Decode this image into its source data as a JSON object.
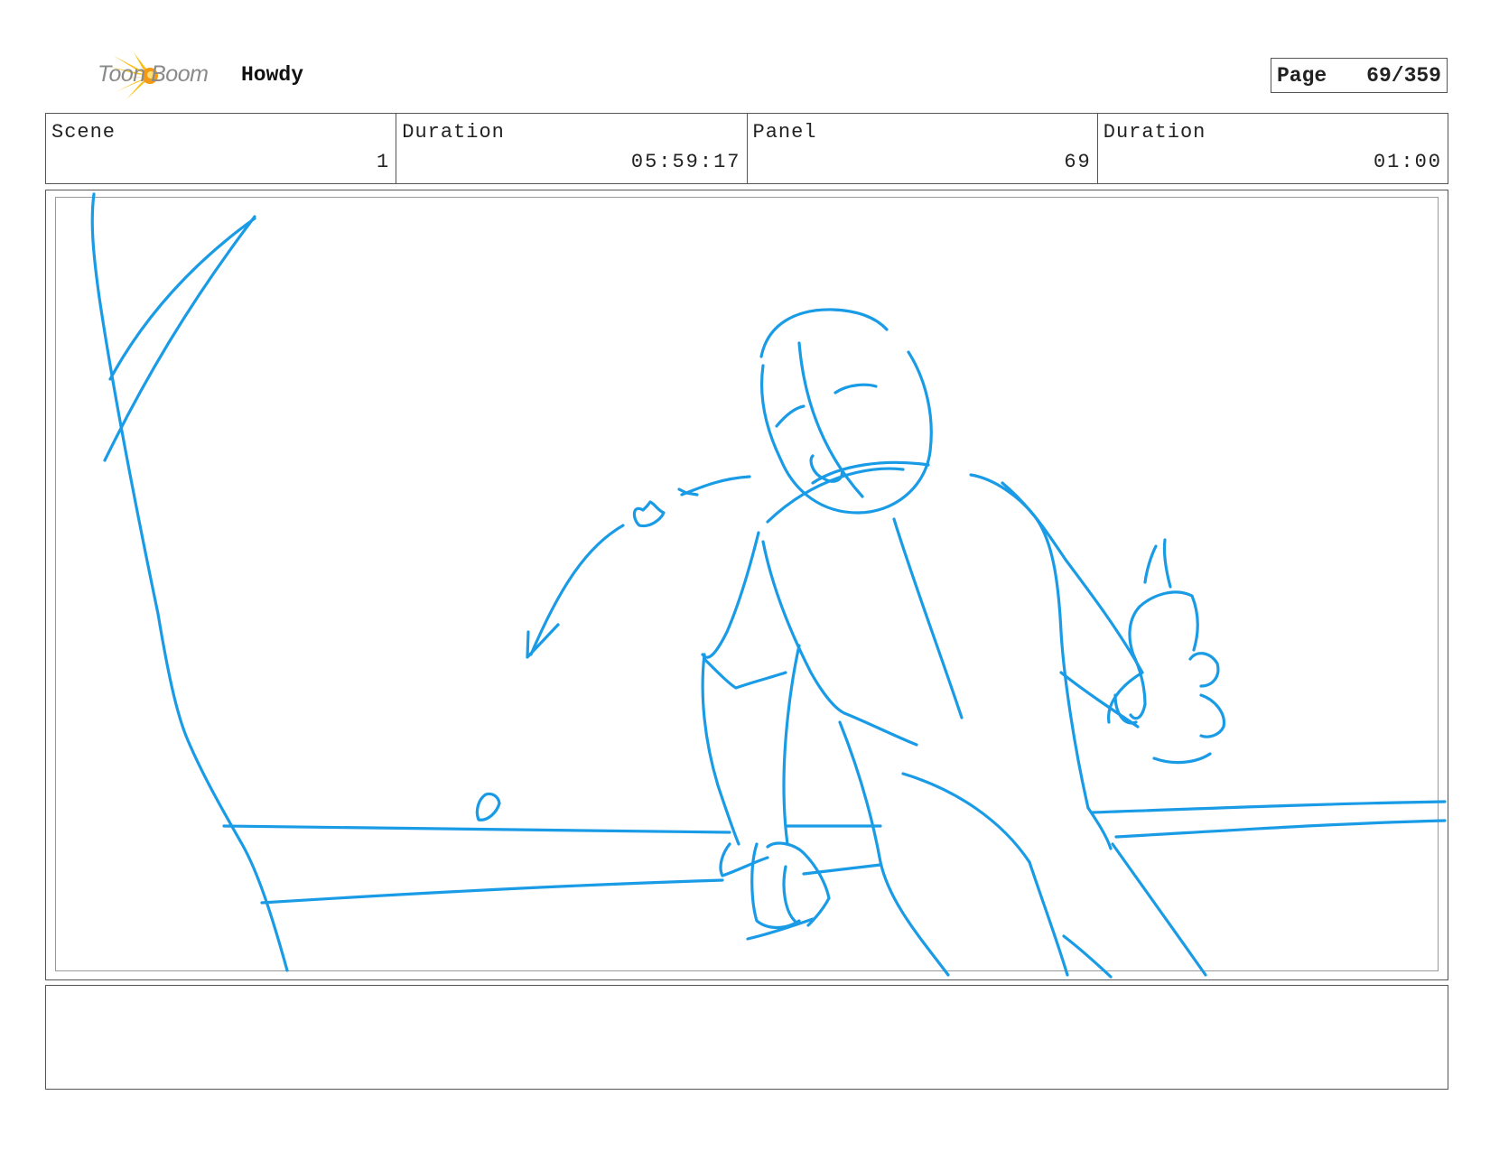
{
  "header": {
    "brand": "Toon Boom",
    "project_title": "Howdy",
    "page_label": "Page",
    "page_value": "69/359"
  },
  "info": {
    "scene_label": "Scene",
    "scene_value": "1",
    "scene_duration_label": "Duration",
    "scene_duration_value": "05:59:17",
    "panel_label": "Panel",
    "panel_value": "69",
    "panel_duration_label": "Duration",
    "panel_duration_value": "01:00"
  },
  "notes": {
    "text": ""
  },
  "colors": {
    "sketch_stroke": "#1a9be6",
    "logo_yellow": "#f6c11a",
    "logo_orange": "#f39a12"
  }
}
